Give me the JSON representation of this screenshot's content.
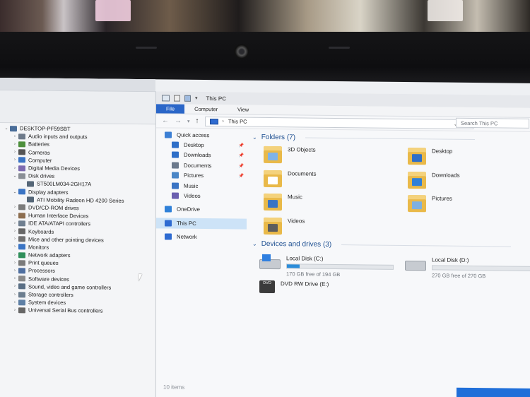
{
  "explorer": {
    "window_title": "This PC",
    "ribbon_tabs": [
      "File",
      "Computer",
      "View"
    ],
    "address": "This PC",
    "search_placeholder": "Search This PC",
    "nav_pane": [
      {
        "label": "Quick access",
        "icon": "star-icon",
        "pinned": false
      },
      {
        "label": "Desktop",
        "icon": "desktop-folder-icon",
        "pinned": true
      },
      {
        "label": "Downloads",
        "icon": "download-icon",
        "pinned": true
      },
      {
        "label": "Documents",
        "icon": "documents-icon",
        "pinned": true
      },
      {
        "label": "Pictures",
        "icon": "pictures-icon",
        "pinned": true
      },
      {
        "label": "Music",
        "icon": "music-icon",
        "pinned": false
      },
      {
        "label": "Videos",
        "icon": "videos-icon",
        "pinned": false
      },
      {
        "label": "OneDrive",
        "icon": "cloud-icon",
        "pinned": false
      },
      {
        "label": "This PC",
        "icon": "computer-icon",
        "pinned": false,
        "selected": true
      },
      {
        "label": "Network",
        "icon": "network-icon",
        "pinned": false
      }
    ],
    "folders_header": "Folders (7)",
    "folders": [
      {
        "label": "3D Objects",
        "icon": "3d-objects-folder-icon"
      },
      {
        "label": "Desktop",
        "icon": "desktop-folder-icon"
      },
      {
        "label": "Documents",
        "icon": "documents-folder-icon"
      },
      {
        "label": "Downloads",
        "icon": "downloads-folder-icon"
      },
      {
        "label": "Music",
        "icon": "music-folder-icon"
      },
      {
        "label": "Pictures",
        "icon": "pictures-folder-icon"
      },
      {
        "label": "Videos",
        "icon": "videos-folder-icon"
      }
    ],
    "drives_header": "Devices and drives (3)",
    "drives": [
      {
        "label": "Local Disk (C:)",
        "free": "170 GB free of 194 GB",
        "used_fraction": 0.12,
        "icon": "system-drive-icon"
      },
      {
        "label": "Local Disk (D:)",
        "free": "270 GB free of 270 GB",
        "used_fraction": 0.0,
        "icon": "drive-icon"
      },
      {
        "label": "DVD RW Drive (E:)",
        "icon": "dvd-drive-icon"
      }
    ],
    "status": "10 items"
  },
  "device_manager": {
    "root": "DESKTOP-PF59SBT",
    "nodes": [
      {
        "label": "Audio inputs and outputs",
        "expanded": false,
        "icon": "speaker-icon"
      },
      {
        "label": "Batteries",
        "expanded": false,
        "icon": "battery-icon"
      },
      {
        "label": "Cameras",
        "expanded": false,
        "icon": "camera-icon"
      },
      {
        "label": "Computer",
        "expanded": false,
        "icon": "computer-icon"
      },
      {
        "label": "Digital Media Devices",
        "expanded": false,
        "icon": "media-device-icon"
      },
      {
        "label": "Disk drives",
        "expanded": true,
        "icon": "disk-drive-icon",
        "children": [
          "ST500LM034-2GH17A"
        ]
      },
      {
        "label": "Display adapters",
        "expanded": true,
        "icon": "display-adapter-icon",
        "children": [
          "ATI Mobility Radeon HD 4200 Series"
        ]
      },
      {
        "label": "DVD/CD-ROM drives",
        "expanded": false,
        "icon": "dvd-icon"
      },
      {
        "label": "Human Interface Devices",
        "expanded": false,
        "icon": "hid-icon"
      },
      {
        "label": "IDE ATA/ATAPI controllers",
        "expanded": false,
        "icon": "ide-controller-icon"
      },
      {
        "label": "Keyboards",
        "expanded": false,
        "icon": "keyboard-icon"
      },
      {
        "label": "Mice and other pointing devices",
        "expanded": false,
        "icon": "mouse-icon"
      },
      {
        "label": "Monitors",
        "expanded": false,
        "icon": "monitor-icon"
      },
      {
        "label": "Network adapters",
        "expanded": false,
        "icon": "network-adapter-icon"
      },
      {
        "label": "Print queues",
        "expanded": false,
        "icon": "printer-icon"
      },
      {
        "label": "Processors",
        "expanded": false,
        "icon": "processor-icon"
      },
      {
        "label": "Software devices",
        "expanded": false,
        "icon": "software-device-icon"
      },
      {
        "label": "Sound, video and game controllers",
        "expanded": false,
        "icon": "sound-icon"
      },
      {
        "label": "Storage controllers",
        "expanded": false,
        "icon": "storage-controller-icon"
      },
      {
        "label": "System devices",
        "expanded": false,
        "icon": "system-device-icon"
      },
      {
        "label": "Universal Serial Bus controllers",
        "expanded": false,
        "icon": "usb-icon"
      }
    ]
  },
  "colors": {
    "accent": "#2a66c8",
    "folder": "#e9b949",
    "selection": "#cde3f7",
    "group_header": "#1d4f91",
    "drive_bar": "#2b8cd9"
  }
}
